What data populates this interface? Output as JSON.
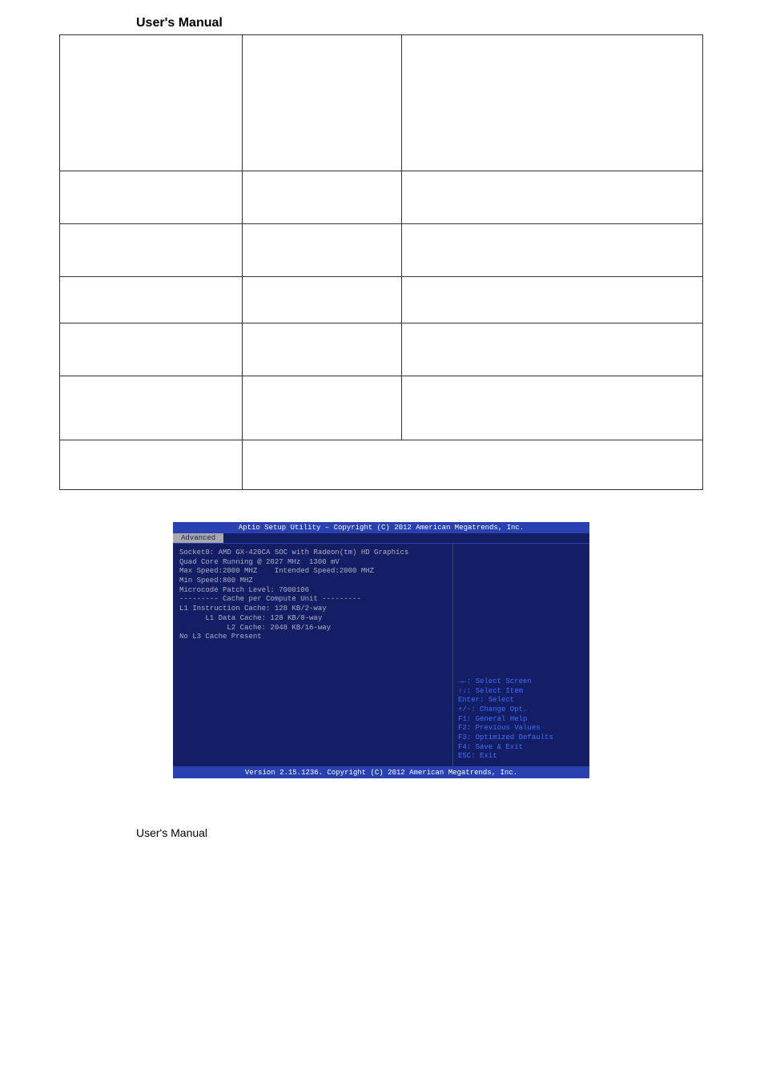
{
  "header": {
    "title": "User's Manual"
  },
  "table": {
    "rows": [
      [
        "",
        "",
        ""
      ],
      [
        "",
        "",
        ""
      ],
      [
        "",
        "",
        ""
      ],
      [
        "",
        "",
        ""
      ],
      [
        "",
        "",
        ""
      ],
      [
        "",
        "",
        ""
      ],
      [
        "",
        ""
      ]
    ]
  },
  "bios": {
    "title_bar": "Aptio Setup Utility – Copyright (C) 2012 American Megatrends, Inc.",
    "active_tab": "Advanced",
    "left_lines": [
      "Socket0: AMD GX-420CA SOC with Radeon(tm) HD Graphics",
      "Quad Core Running @ 2027 MHz  1300 mV",
      "Max Speed:2000 MHZ    Intended Speed:2000 MHZ",
      "Min Speed:800 MHZ",
      "Microcode Patch Level: 7000106",
      "",
      "--------- Cache per Compute Unit ---------",
      "L1 Instruction Cache: 128 KB/2-way",
      "      L1 Data Cache: 128 KB/8-way",
      "           L2 Cache: 2048 KB/16-way",
      "No L3 Cache Present"
    ],
    "help_lines": [
      "→←: Select Screen",
      "↑↓: Select Item",
      "Enter: Select",
      "+/-: Change Opt.",
      "F1: General Help",
      "F2: Previous Values",
      "F3: Optimized Defaults",
      "F4: Save & Exit",
      "ESC: Exit"
    ],
    "footer": "Version 2.15.1236. Copyright (C) 2012 American Megatrends, Inc."
  },
  "footer": {
    "text": "User's Manual"
  }
}
